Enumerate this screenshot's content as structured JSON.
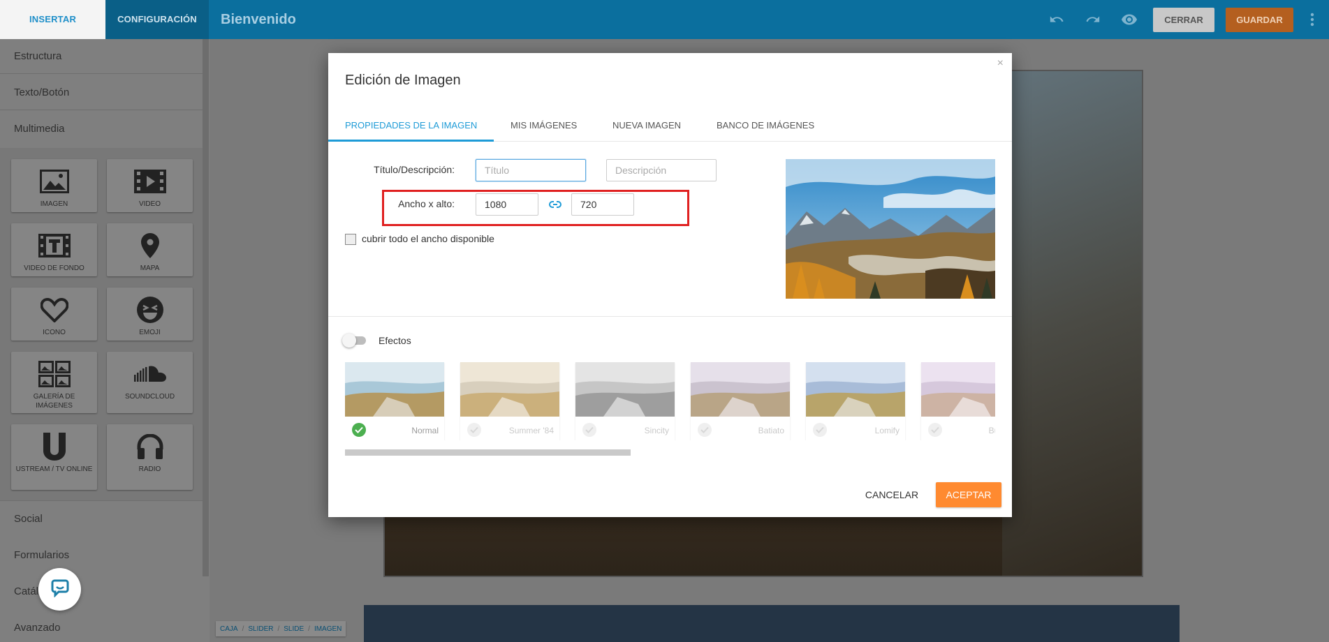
{
  "topbar": {
    "tab_insert": "INSERTAR",
    "tab_config": "CONFIGURACIÓN",
    "title": "Bienvenido",
    "close_label": "CERRAR",
    "save_label": "GUARDAR",
    "icons": [
      "undo-icon",
      "redo-icon",
      "eye-icon",
      "more-vert-icon"
    ]
  },
  "sidebar": {
    "sections_top": [
      "Estructura",
      "Texto/Botón",
      "Multimedia"
    ],
    "widgets": [
      {
        "label": "IMAGEN",
        "icon": "image-icon"
      },
      {
        "label": "VIDEO",
        "icon": "film-icon"
      },
      {
        "label": "VIDEO DE FONDO",
        "icon": "video-background-icon"
      },
      {
        "label": "MAPA",
        "icon": "map-pin-icon"
      },
      {
        "label": "ICONO",
        "icon": "heart-icon"
      },
      {
        "label": "EMOJI",
        "icon": "emoji-icon"
      },
      {
        "label": "GALERÍA DE IMÁGENES",
        "icon": "gallery-icon"
      },
      {
        "label": "SOUNDCLOUD",
        "icon": "soundcloud-icon"
      },
      {
        "label": "USTREAM / TV ONLINE",
        "icon": "ustream-icon"
      },
      {
        "label": "RADIO",
        "icon": "headphones-icon"
      }
    ],
    "sections_bottom": [
      "Social",
      "Formularios",
      "Catálogo",
      "Avanzado"
    ]
  },
  "breadcrumb": [
    "CAJA",
    "SLIDER",
    "SLIDE",
    "IMAGEN"
  ],
  "modal": {
    "title": "Edición de Imagen",
    "close_symbol": "×",
    "tabs": [
      "PROPIEDADES DE LA IMAGEN",
      "MIS IMÁGENES",
      "NUEVA IMAGEN",
      "BANCO DE IMÁGENES"
    ],
    "active_tab": "PROPIEDADES DE LA IMAGEN",
    "title_label": "Título/Descripción:",
    "title_placeholder": "Título",
    "description_placeholder": "Descripción",
    "size_label": "Ancho x alto:",
    "width_value": "1080",
    "height_value": "720",
    "cover_label": "cubrir todo el ancho disponible",
    "cover_checked": false,
    "effects_label": "Efectos",
    "effects_enabled": false,
    "effects": [
      {
        "name": "Normal",
        "selected": true
      },
      {
        "name": "Summer '84",
        "selected": false
      },
      {
        "name": "Sincity",
        "selected": false
      },
      {
        "name": "Batiato",
        "selected": false
      },
      {
        "name": "Lomify",
        "selected": false
      },
      {
        "name": "Bubble",
        "selected": false
      }
    ],
    "cancel_label": "CANCELAR",
    "accept_label": "ACEPTAR"
  },
  "colors": {
    "accent_blue": "#1e9bd7",
    "topbar_blue": "#0b6f9e",
    "orange": "#ff8a30",
    "highlight_red": "#e02020"
  }
}
